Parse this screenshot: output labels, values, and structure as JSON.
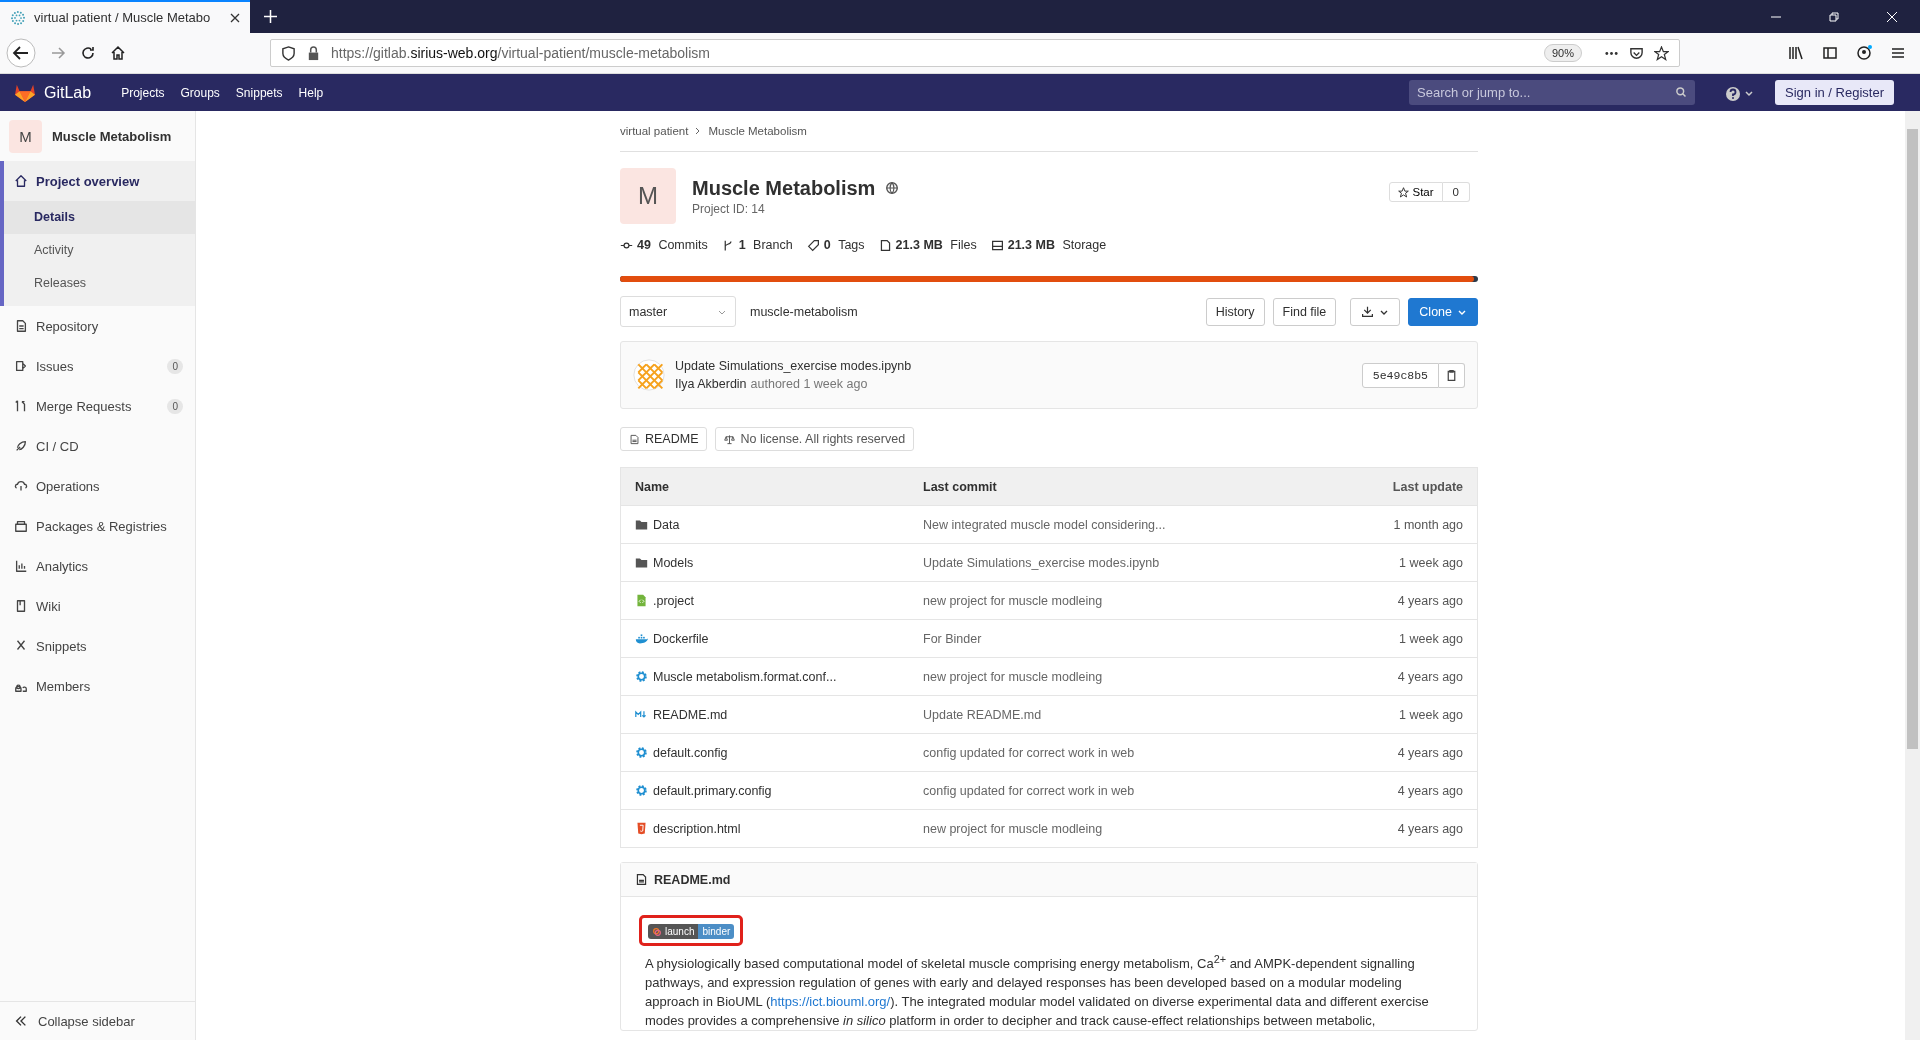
{
  "browser": {
    "tab_title": "virtual patient / Muscle Metabo",
    "url_prefix": "https://gitlab.",
    "url_host": "sirius-web.org",
    "url_path": "/virtual-patient/muscle-metabolism",
    "zoom": "90%"
  },
  "header": {
    "logo_text": "GitLab",
    "nav": [
      "Projects",
      "Groups",
      "Snippets",
      "Help"
    ],
    "search": {
      "placeholder": "Search or jump to..."
    },
    "sign_in": "Sign in / Register"
  },
  "sidebar": {
    "project_letter": "M",
    "project_name": "Muscle Metabolism",
    "items": [
      {
        "label": "Project overview",
        "selected": true,
        "children": [
          {
            "label": "Details",
            "selected": true
          },
          {
            "label": "Activity",
            "selected": false
          },
          {
            "label": "Releases",
            "selected": false
          }
        ]
      },
      {
        "label": "Repository",
        "selected": false
      },
      {
        "label": "Issues",
        "selected": false,
        "count": "0"
      },
      {
        "label": "Merge Requests",
        "selected": false,
        "count": "0"
      },
      {
        "label": "CI / CD",
        "selected": false
      },
      {
        "label": "Operations",
        "selected": false
      },
      {
        "label": "Packages & Registries",
        "selected": false
      },
      {
        "label": "Analytics",
        "selected": false
      },
      {
        "label": "Wiki",
        "selected": false
      },
      {
        "label": "Snippets",
        "selected": false
      },
      {
        "label": "Members",
        "selected": false
      }
    ],
    "collapse": "Collapse sidebar"
  },
  "breadcrumbs": [
    "virtual patient",
    "Muscle Metabolism"
  ],
  "project": {
    "letter": "M",
    "name": "Muscle Metabolism",
    "id_text": "Project ID: 14",
    "star_label": "Star",
    "star_count": "0"
  },
  "stats": [
    {
      "kind": "commits",
      "value": "49",
      "label": "Commits"
    },
    {
      "kind": "branch",
      "value": "1",
      "label": "Branch"
    },
    {
      "kind": "tags",
      "value": "0",
      "label": "Tags"
    },
    {
      "kind": "files",
      "value": "21.3 MB",
      "label": "Files"
    },
    {
      "kind": "storage",
      "value": "21.3 MB",
      "label": "Storage"
    }
  ],
  "language_bar": {
    "level": 0.995
  },
  "branch": "master",
  "repo_path": "muscle-metabolism",
  "actions": [
    "History",
    "Find file"
  ],
  "clone": "Clone",
  "last_commit": {
    "message": "Update Simulations_exercise modes.ipynb",
    "author": "Ilya Akberdin",
    "meta": "authored 1 week ago",
    "sha": "5e49c8b5"
  },
  "readme_buttons": [
    {
      "kind": "readme",
      "label": "README"
    },
    {
      "kind": "license",
      "label": "No license. All rights reserved"
    }
  ],
  "table": {
    "columns": [
      "Name",
      "Last commit",
      "Last update"
    ],
    "rows": [
      {
        "kind": "folder",
        "name": "Data",
        "commit": "New integrated muscle model considering...",
        "updated": "1 month ago"
      },
      {
        "kind": "folder",
        "name": "Models",
        "commit": "Update Simulations_exercise modes.ipynb",
        "updated": "1 week ago"
      },
      {
        "kind": "code",
        "name": ".project",
        "commit": "new project for muscle modleing",
        "updated": "4 years ago"
      },
      {
        "kind": "docker",
        "name": "Dockerfile",
        "commit": "For Binder",
        "updated": "1 week ago"
      },
      {
        "kind": "config",
        "name": "Muscle metabolism.format.conf...",
        "commit": "new project for muscle modleing",
        "updated": "4 years ago"
      },
      {
        "kind": "markdown",
        "name": "README.md",
        "commit": "Update README.md",
        "updated": "1 week ago"
      },
      {
        "kind": "config",
        "name": "default.config",
        "commit": "config updated for correct work in web",
        "updated": "4 years ago"
      },
      {
        "kind": "config",
        "name": "default.primary.config",
        "commit": "config updated for correct work in web",
        "updated": "4 years ago"
      },
      {
        "kind": "html",
        "name": "description.html",
        "commit": "new project for muscle modleing",
        "updated": "4 years ago"
      }
    ]
  },
  "readme": {
    "title": "README.md",
    "badge_left": "launch",
    "badge_right": "binder",
    "text_before": "A physiologically based computational model of skeletal muscle comprising energy metabolism, Ca$^{2+}$ and AMPK-dependent signalling pathways, and expression regulation of genes with early and delayed responses has been developed based on a modular modeling approach in BioUML (",
    "link": "https://ict.biouml.org/",
    "text_after": "). The integrated modular model validated on diverse experimental data and different exercise modes provides a comprehensive *in silico* platform in order to decipher and track cause-effect relationships between metabolic,"
  }
}
